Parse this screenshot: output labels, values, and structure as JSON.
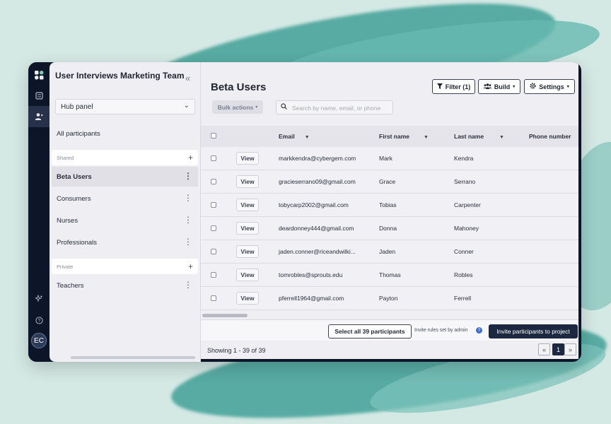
{
  "sidebar": {
    "team_title": "User Interviews Marketing Team",
    "hub_select": "Hub panel",
    "all_participants": "All participants",
    "shared_label": "Shared",
    "private_label": "Private",
    "shared_items": [
      {
        "label": "Beta Users"
      },
      {
        "label": "Consumers"
      },
      {
        "label": "Nurses"
      },
      {
        "label": "Professionals"
      }
    ],
    "private_items": [
      {
        "label": "Teachers"
      }
    ]
  },
  "rail": {
    "avatar_initials": "EC"
  },
  "main": {
    "title": "Beta Users",
    "filter_label": "Filter (1)",
    "build_label": "Build",
    "settings_label": "Settings",
    "bulk_actions_label": "Bulk actions",
    "search_placeholder": "Search by name, email, or phone",
    "columns": [
      "Email",
      "First name",
      "Last name",
      "Phone number"
    ],
    "view_label": "View",
    "rows": [
      {
        "email": "markkendra@cybergem.com",
        "first": "Mark",
        "last": "Kendra"
      },
      {
        "email": "gracieserrano09@gmail.com",
        "first": "Grace",
        "last": "Serrano"
      },
      {
        "email": "tobycarp2002@gmail.com",
        "first": "Tobias",
        "last": "Carpenter"
      },
      {
        "email": "deardonney444@gmail.com",
        "first": "Donna",
        "last": "Mahoney"
      },
      {
        "email": "jaden.conner@riceandwilki...",
        "first": "Jaden",
        "last": "Conner"
      },
      {
        "email": "tomrobles@sprouts.edu",
        "first": "Thomas",
        "last": "Robles"
      },
      {
        "email": "pferrell1964@gmail.com",
        "first": "Payton",
        "last": "Ferrell"
      }
    ],
    "select_all_label": "Select all 39 participants",
    "invite_rules": "Invite rules set by admin",
    "invite_label": "Invite participants to project",
    "showing": "Showing 1 - 39 of 39",
    "current_page": "1"
  }
}
